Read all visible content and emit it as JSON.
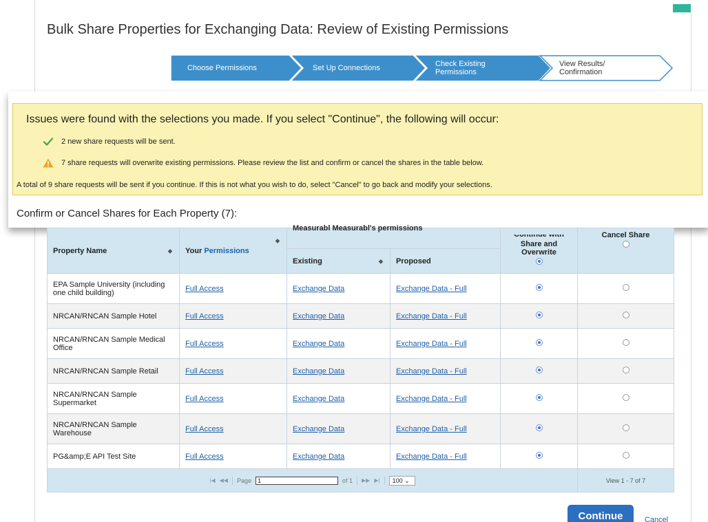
{
  "page": {
    "title": "Bulk Share Properties for Exchanging Data: Review of Existing Permissions"
  },
  "wizard": {
    "steps": [
      {
        "label": "Choose Permissions"
      },
      {
        "label": "Set Up Connections"
      },
      {
        "label": "Check Existing Permissions"
      },
      {
        "label": "View Results/ Confirmation"
      }
    ]
  },
  "colors": {
    "wizard_active": "#3d8fcb",
    "banner_bg": "#fbf3b6",
    "header_bg": "#d1e6f1",
    "link": "#1f5fa8",
    "primary_button": "#2b6fc0"
  },
  "banner": {
    "heading": "Issues were found with the selections you made. If you select \"Continue\", the following will occur:",
    "items": [
      {
        "icon": "check-icon",
        "text": "2 new share requests will be sent."
      },
      {
        "icon": "warning-icon",
        "text": "7 share requests will overwrite existing permissions. Please review the list and confirm or cancel the shares in the table below."
      }
    ],
    "footer": "A total of 9 share requests will be sent if you continue. If this is not what you wish to do, select \"Cancel\" to go back and modify your selections."
  },
  "section_title": "Confirm or Cancel Shares for Each Property (7):",
  "table": {
    "headers": {
      "property_name": "Property Name",
      "your_prefix": "Your",
      "your_link": "Permissions",
      "group": "Measurabl Measurabl's permissions",
      "existing": "Existing",
      "proposed": "Proposed",
      "continue_line1": "Continue with",
      "continue_line2": "Share and",
      "continue_line3": "Overwrite",
      "cancel_share": "Cancel Share"
    },
    "rows": [
      {
        "property": "EPA Sample University (including one child building)",
        "your": "Full Access",
        "existing": "Exchange Data",
        "proposed": "Exchange Data - Full",
        "choice": "continue"
      },
      {
        "property": "NRCAN/RNCAN Sample Hotel",
        "your": "Full Access",
        "existing": "Exchange Data",
        "proposed": "Exchange Data - Full",
        "choice": "continue"
      },
      {
        "property": "NRCAN/RNCAN Sample Medical Office",
        "your": "Full Access",
        "existing": "Exchange Data",
        "proposed": "Exchange Data - Full",
        "choice": "continue"
      },
      {
        "property": "NRCAN/RNCAN Sample Retail",
        "your": "Full Access",
        "existing": "Exchange Data",
        "proposed": "Exchange Data - Full",
        "choice": "continue"
      },
      {
        "property": "NRCAN/RNCAN Sample Supermarket",
        "your": "Full Access",
        "existing": "Exchange Data",
        "proposed": "Exchange Data - Full",
        "choice": "continue"
      },
      {
        "property": "NRCAN/RNCAN Sample Warehouse",
        "your": "Full Access",
        "existing": "Exchange Data",
        "proposed": "Exchange Data - Full",
        "choice": "continue"
      },
      {
        "property": "PG&amp;E API Test Site",
        "your": "Full Access",
        "existing": "Exchange Data",
        "proposed": "Exchange Data - Full",
        "choice": "continue"
      }
    ],
    "pager": {
      "page_label": "Page",
      "page_value": "1",
      "of_label": "of 1",
      "rows_per_page": "100",
      "view_count": "View 1 - 7 of 7"
    }
  },
  "actions": {
    "continue_label": "Continue",
    "cancel_label": "Cancel"
  }
}
